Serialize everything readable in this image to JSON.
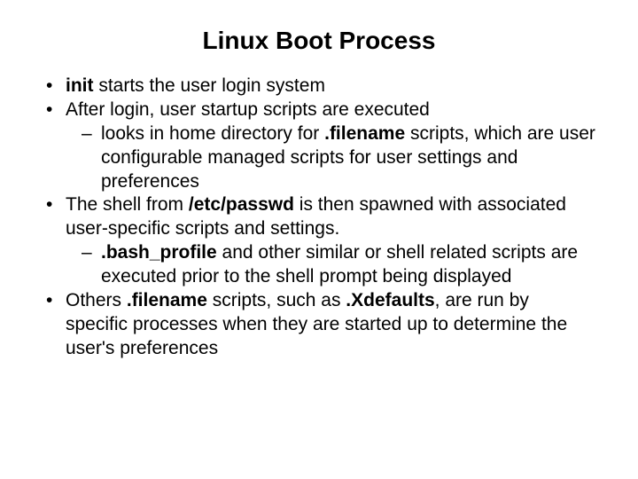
{
  "title": "Linux Boot Process",
  "b1_init": "init",
  "b1_rest": " starts the user login system",
  "b2": "After login, user startup scripts are executed",
  "b2s_pre": "looks in home directory for ",
  "b2s_bold": ".filename",
  "b2s_post": " scripts, which are user configurable managed scripts for user settings and preferences",
  "b3_pre": "The shell from ",
  "b3_bold": "/etc/passwd",
  "b3_post": " is then spawned with associated user-specific scripts and settings.",
  "b3s_bold": ".bash_profile",
  "b3s_post": " and other similar or shell related scripts are executed prior to the shell prompt being displayed",
  "b4_pre": "Others ",
  "b4_bold1": ".filename",
  "b4_mid": " scripts, such as ",
  "b4_bold2": ".Xdefaults",
  "b4_post": ", are run by specific processes when they are started up to determine the user's preferences"
}
